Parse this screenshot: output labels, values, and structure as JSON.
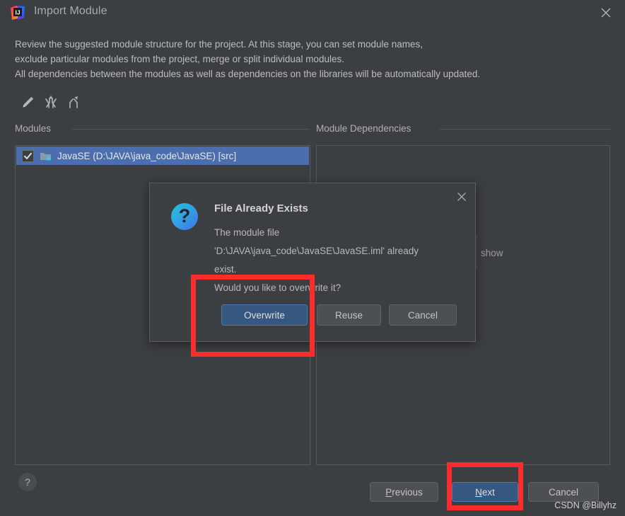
{
  "window": {
    "title": "Import Module",
    "logo_icon": "intellij-idea-logo",
    "close_icon": "close-icon"
  },
  "description": {
    "line1": "Review the suggested module structure for the project. At this stage, you can set module names,",
    "line2": "exclude particular modules from the project, merge or split individual modules.",
    "line3": "All dependencies between the modules as well as dependencies on the libraries will be automatically updated."
  },
  "toolbar": {
    "edit_icon": "pencil-icon",
    "merge_icon": "merge-modules-icon",
    "split_icon": "split-module-icon"
  },
  "panels": {
    "modules_label": "Modules",
    "dependencies_label": "Module Dependencies",
    "module_row": {
      "checked": true,
      "folder_icon": "module-folder-icon",
      "label": "JavaSE (D:\\JAVA\\java_code\\JavaSE) [src]"
    },
    "dependencies_hint": "show"
  },
  "footer": {
    "help_label": "?",
    "previous_label": "Previous",
    "previous_mnemonic": "P",
    "previous_rest": "revious",
    "next_label": "Next",
    "next_mnemonic_pre": "N",
    "next_rest": "ext",
    "cancel_label": "Cancel"
  },
  "dialog": {
    "title": "File Already Exists",
    "icon": "question-mark-icon",
    "close_icon": "close-icon",
    "body_line1": "The module file",
    "body_line2": "'D:\\JAVA\\java_code\\JavaSE\\JavaSE.iml' already",
    "body_line3": "exist.",
    "body_line4": "Would you like to overwrite it?",
    "overwrite_label": "Overwrite",
    "reuse_label": "Reuse",
    "cancel_label": "Cancel"
  },
  "annotations": {
    "highlight_color": "#fb2c2c",
    "watermark": "CSDN @Billyhz"
  },
  "colors": {
    "background": "#3c3f41",
    "selection": "#4b6eaf",
    "default_button": "#365880",
    "border": "#55595c"
  }
}
